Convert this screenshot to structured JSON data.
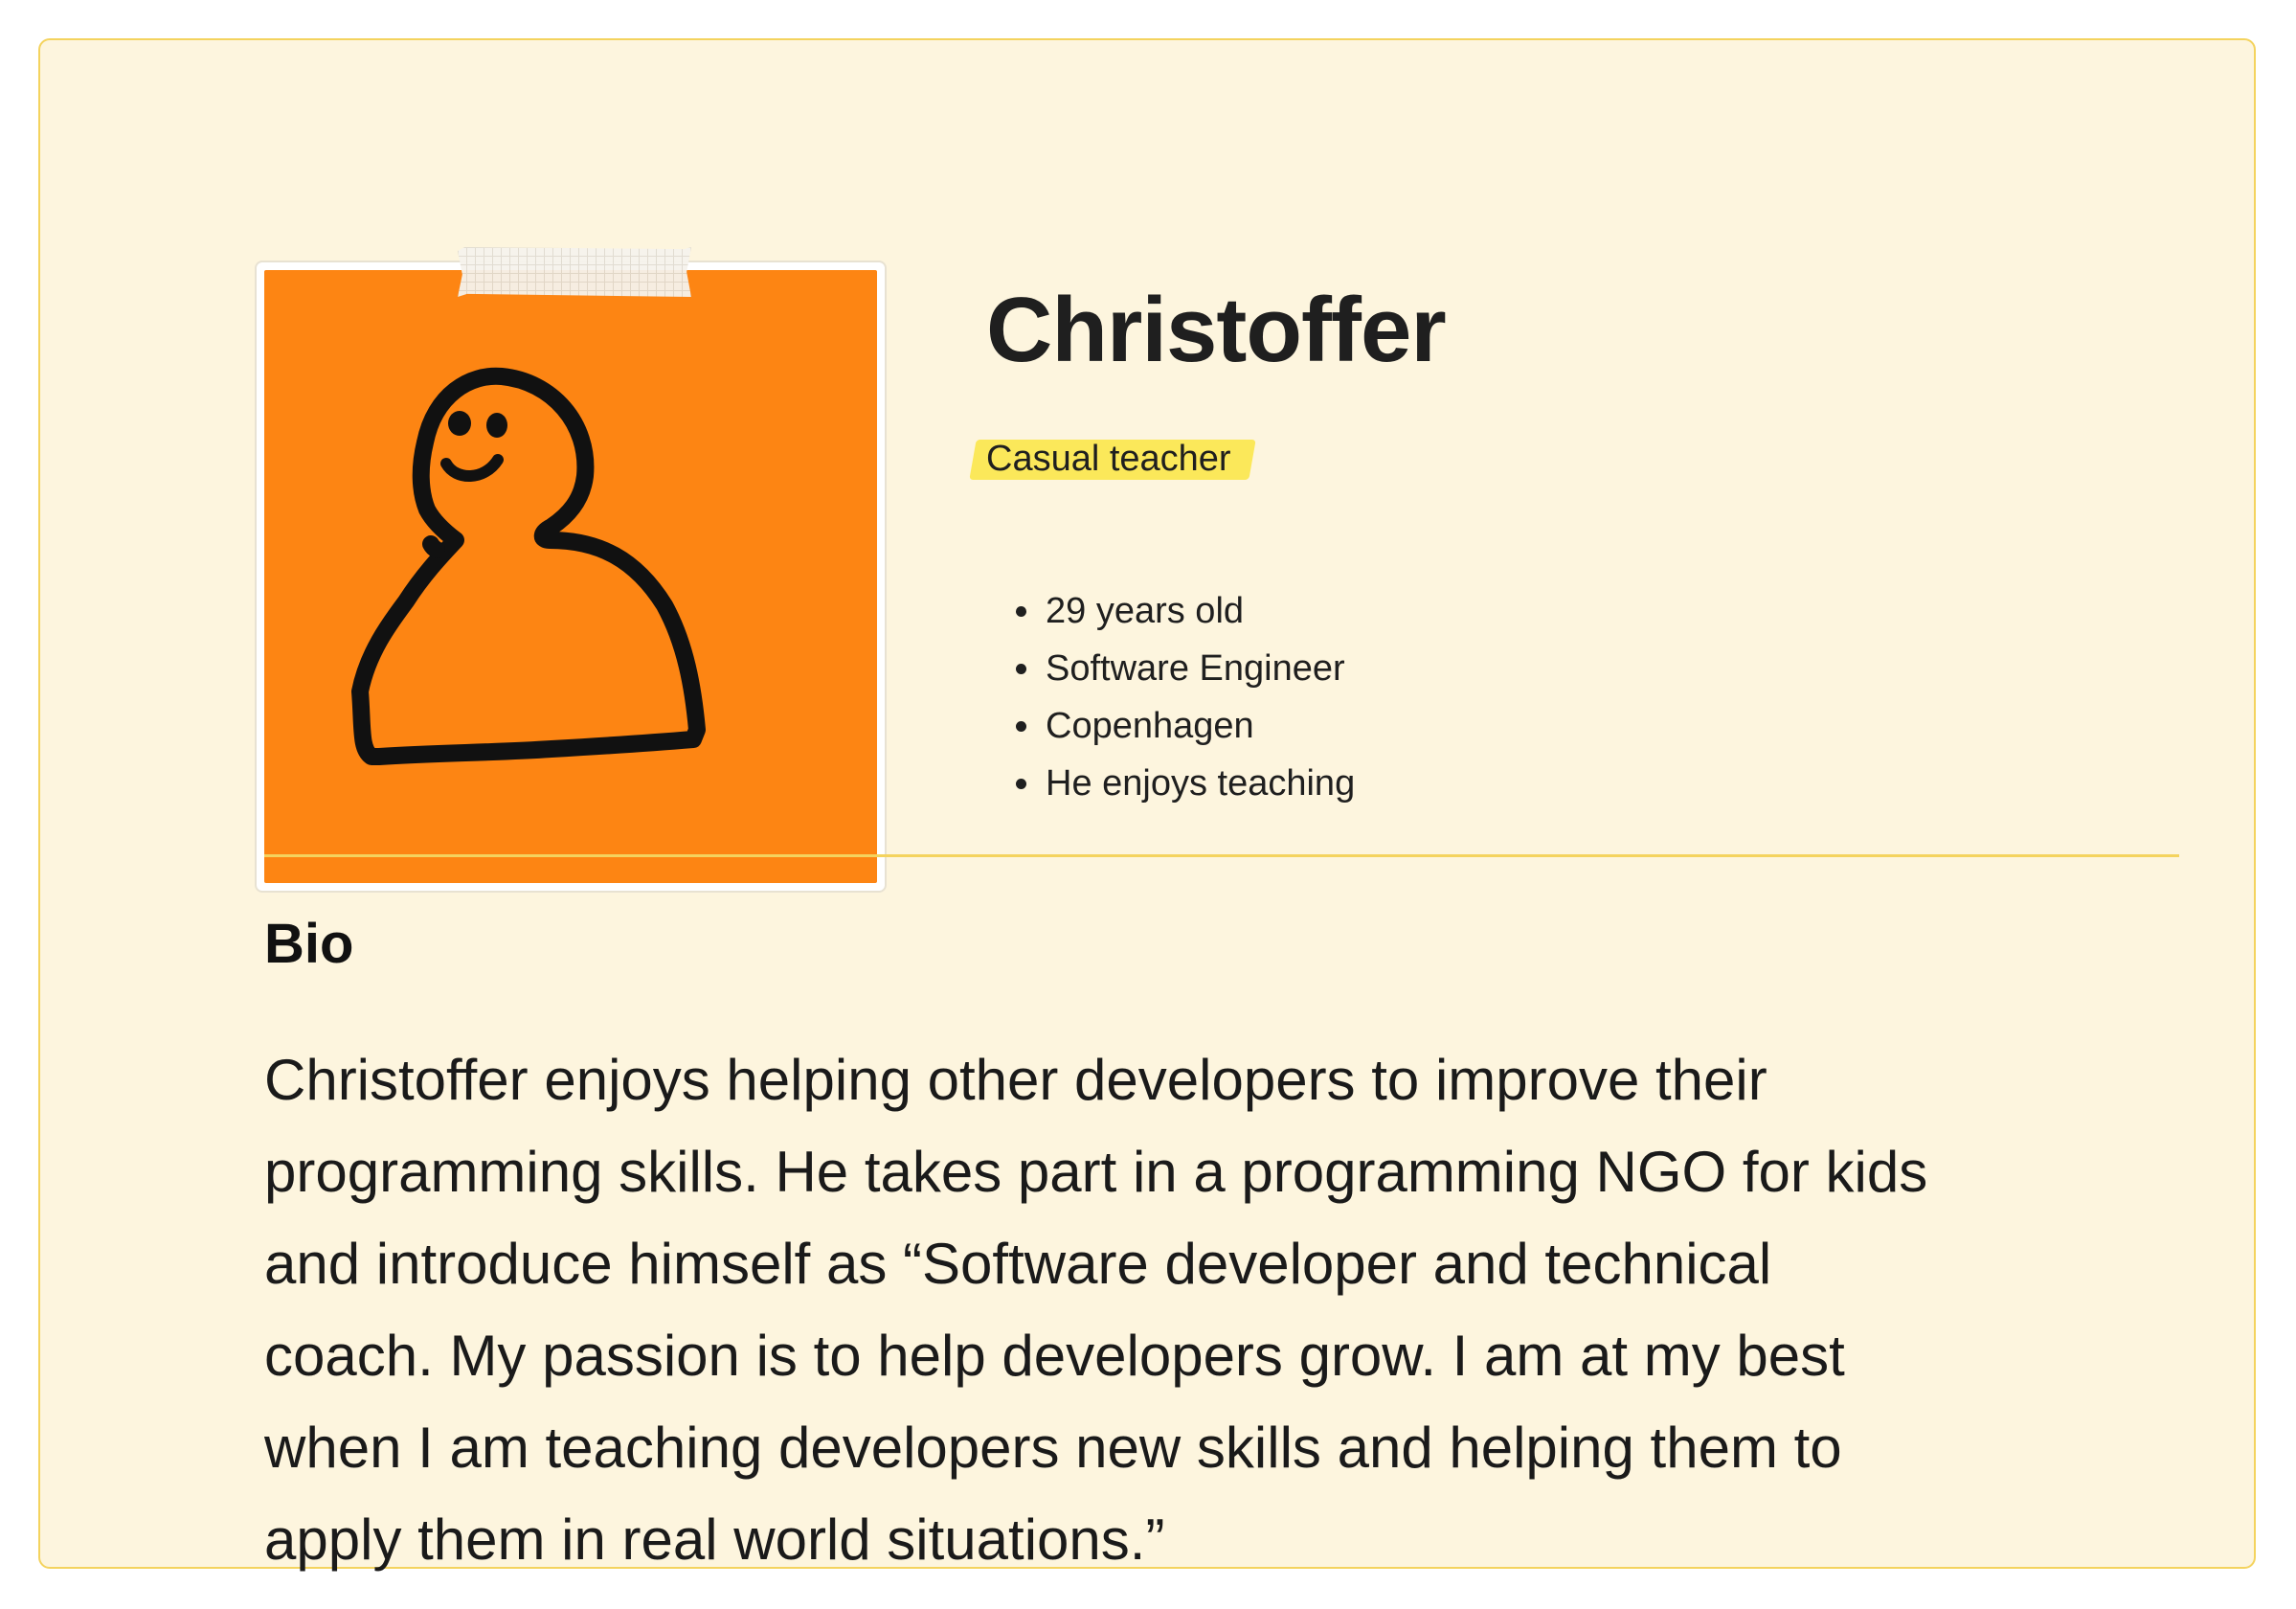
{
  "profile": {
    "name": "Christoffer",
    "role": "Casual teacher",
    "facts": [
      "29 years old",
      "Software Engineer",
      "Copenhagen",
      "He enjoys teaching"
    ]
  },
  "bio": {
    "title": "Bio",
    "text": "Christoffer enjoys helping other developers to improve their\nprogramming skills. He takes part in a programming NGO for kids\nand introduce himself as “Software developer and technical\ncoach. My  passion is to help developers grow. I am at my best\nwhen I am teaching  developers new skills and helping them to\napply them in real world  situations.”"
  },
  "avatar": {
    "icon": "person-doodle-icon",
    "background": "#fd8513"
  },
  "colors": {
    "card_background": "#fdf5de",
    "card_border": "#f4d35e",
    "highlight": "#fbe85a"
  }
}
